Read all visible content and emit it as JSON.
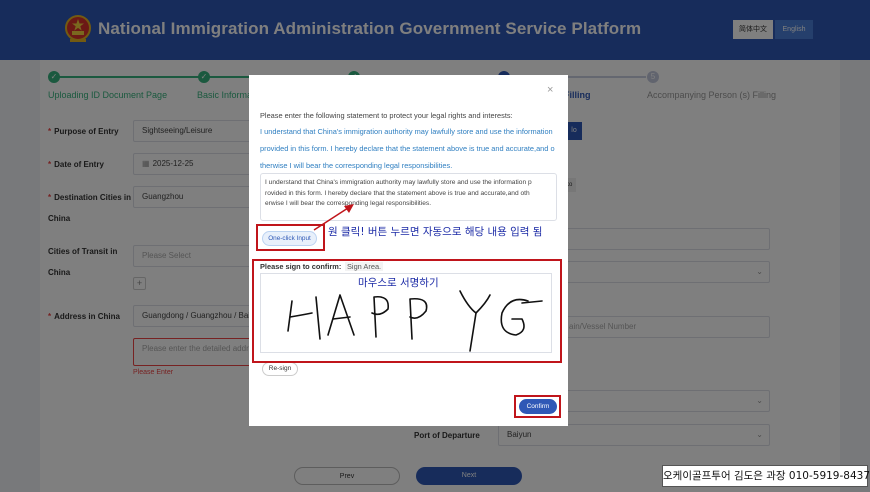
{
  "header": {
    "title": "National Immigration Administration Government Service Platform",
    "lang_zh": "简体中文",
    "lang_en": "English"
  },
  "steps": [
    {
      "label": "Uploading ID Document Page",
      "state": "done"
    },
    {
      "label": "Basic Informa",
      "state": "done"
    },
    {
      "label": "",
      "state": "done"
    },
    {
      "label": "n Filling",
      "state": "current"
    },
    {
      "label": "Accompanying Person (s) Filling",
      "state": "todo",
      "number": "5"
    }
  ],
  "form": {
    "purpose_label": "Purpose of Entry",
    "purpose_value": "Sightseeing/Leisure",
    "date_label": "Date of Entry",
    "date_value": "2025-12-25",
    "dest_label_1": "Destination Cities in",
    "dest_label_2": "China",
    "dest_value": "Guangzhou",
    "transit_label_1": "Cities of Transit in",
    "transit_label_2": "China",
    "transit_placeholder": "Please Select",
    "address_label": "Address in China",
    "address_value": "Guangdong / Guangzhou / Baiyu",
    "address_detail_placeholder": "Please enter the detailed addres",
    "address_error": "Please Enter",
    "right_btn_partial": "lo",
    "right_tag_partial": "ko",
    "vessel_placeholder_partial": "ain/Vessel Number",
    "port_label": "Port of Departure",
    "port_value": "Baiyun"
  },
  "nav": {
    "prev": "Prev",
    "next": "Next"
  },
  "modal": {
    "intro": "Please enter the following statement to protect your legal rights and interests:",
    "statement_lines": [
      "I understand that China's immigration authority may lawfully store and use the information",
      "provided in this form. I hereby declare that the statement above is true and accurate,and o",
      "therwise I will bear the corresponding legal responsibilities."
    ],
    "textarea_lines": [
      "I understand that China's immigration authority may lawfully store and use the information p",
      "rovided in this form. I hereby declare that the statement above is true and accurate,and oth",
      "erwise I will bear the corresponding legal responsibilities."
    ],
    "one_click": "One-click Input",
    "sign_label": "Please sign to confirm:",
    "sign_area": "Sign Area.",
    "resign": "Re-sign",
    "confirm": "Confirm",
    "close": "×"
  },
  "annotations": {
    "one_click_note": "원 클릭! 버튼 누르면 자동으로 해당 내용 입력 됨",
    "sign_note": "마우스로 서명하기",
    "signature": "HAPP YG"
  },
  "watermark": "오케이골프투어 김도은 과장 010-5919-8437",
  "colors": {
    "header_bg": "#2f58b6",
    "step_done": "#36b37e",
    "step_current": "#2f58b6",
    "annotation_red": "#c0151b",
    "annotation_text": "#1b2aa6"
  }
}
